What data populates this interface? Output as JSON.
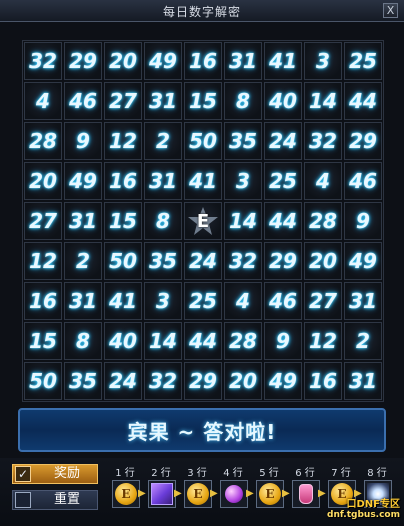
{
  "window": {
    "title": "每日数字解密",
    "close_label": "X"
  },
  "board": {
    "rows": [
      [
        "32",
        "29",
        "20",
        "49",
        "16",
        "31",
        "41",
        "3",
        "25"
      ],
      [
        "4",
        "46",
        "27",
        "31",
        "15",
        "8",
        "40",
        "14",
        "44"
      ],
      [
        "28",
        "9",
        "12",
        "2",
        "50",
        "35",
        "24",
        "32",
        "29"
      ],
      [
        "20",
        "49",
        "16",
        "31",
        "41",
        "3",
        "25",
        "4",
        "46"
      ],
      [
        "27",
        "31",
        "15",
        "8",
        "E",
        "14",
        "44",
        "28",
        "9"
      ],
      [
        "12",
        "2",
        "50",
        "35",
        "24",
        "32",
        "29",
        "20",
        "49"
      ],
      [
        "16",
        "31",
        "41",
        "3",
        "25",
        "4",
        "46",
        "27",
        "31"
      ],
      [
        "15",
        "8",
        "40",
        "14",
        "44",
        "28",
        "9",
        "12",
        "2"
      ],
      [
        "50",
        "35",
        "24",
        "32",
        "29",
        "20",
        "49",
        "16",
        "31"
      ]
    ],
    "center_label": "E"
  },
  "banner": {
    "text": "宾果 ~ 答对啦!"
  },
  "options": {
    "reward_label": "奖励",
    "reward_checked": true,
    "reset_label": "重置",
    "reset_checked": false
  },
  "rewards": [
    {
      "row": "1 行",
      "icon": "gold-coin-icon",
      "badge": "E"
    },
    {
      "row": "2 行",
      "icon": "purple-cube-icon",
      "badge": ""
    },
    {
      "row": "3 行",
      "icon": "gold-coin-icon",
      "badge": "E"
    },
    {
      "row": "4 行",
      "icon": "purple-orb-icon",
      "badge": ""
    },
    {
      "row": "5 行",
      "icon": "gold-coin-icon",
      "badge": "E"
    },
    {
      "row": "6 行",
      "icon": "potion-icon",
      "badge": ""
    },
    {
      "row": "7 行",
      "icon": "gold-coin-icon",
      "badge": "E"
    },
    {
      "row": "8 行",
      "icon": "sparkle-icon",
      "badge": ""
    }
  ],
  "watermark": {
    "line1": "口DNF专区",
    "line2": "dnf.tgbus.com"
  }
}
